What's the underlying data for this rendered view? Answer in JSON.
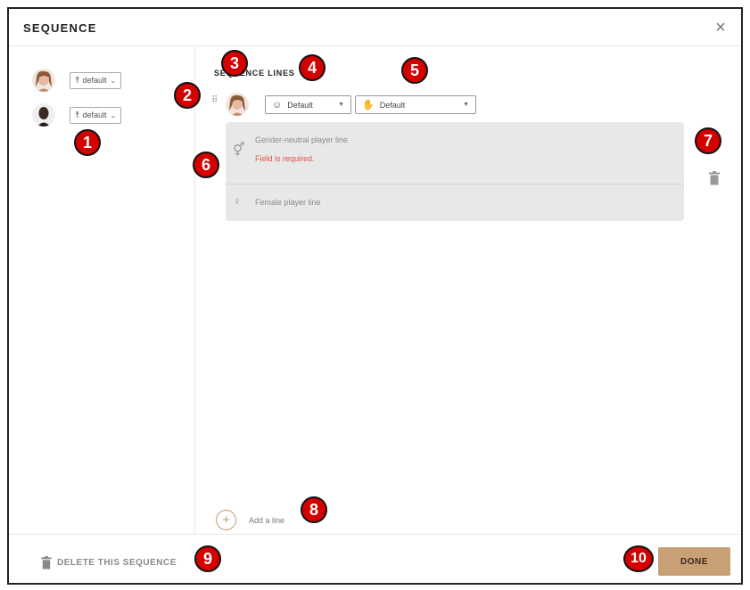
{
  "dialog": {
    "title": "SEQUENCE",
    "close_glyph": "×"
  },
  "actors": [
    {
      "avatar": "avatar-female-light",
      "pose_label": "default"
    },
    {
      "avatar": "avatar-dark",
      "pose_label": "default"
    }
  ],
  "sequence": {
    "section_title": "SEQUENCE LINES",
    "emote_label": "Default",
    "gesture_label": "Default",
    "lines": [
      {
        "gender_icon": "gender-neutral-icon",
        "placeholder": "Gender-neutral player line",
        "error": "Field is required."
      },
      {
        "gender_icon": "female-icon",
        "placeholder": "Female player line"
      }
    ],
    "add_line_label": "Add a line"
  },
  "footer": {
    "delete_label": "DELETE THIS SEQUENCE",
    "done_label": "DONE"
  },
  "callouts": [
    "1",
    "2",
    "3",
    "4",
    "5",
    "6",
    "7",
    "8",
    "9",
    "10"
  ],
  "colors": {
    "accent": "#c9a076",
    "error": "#e0524a",
    "callout": "#d40000"
  }
}
